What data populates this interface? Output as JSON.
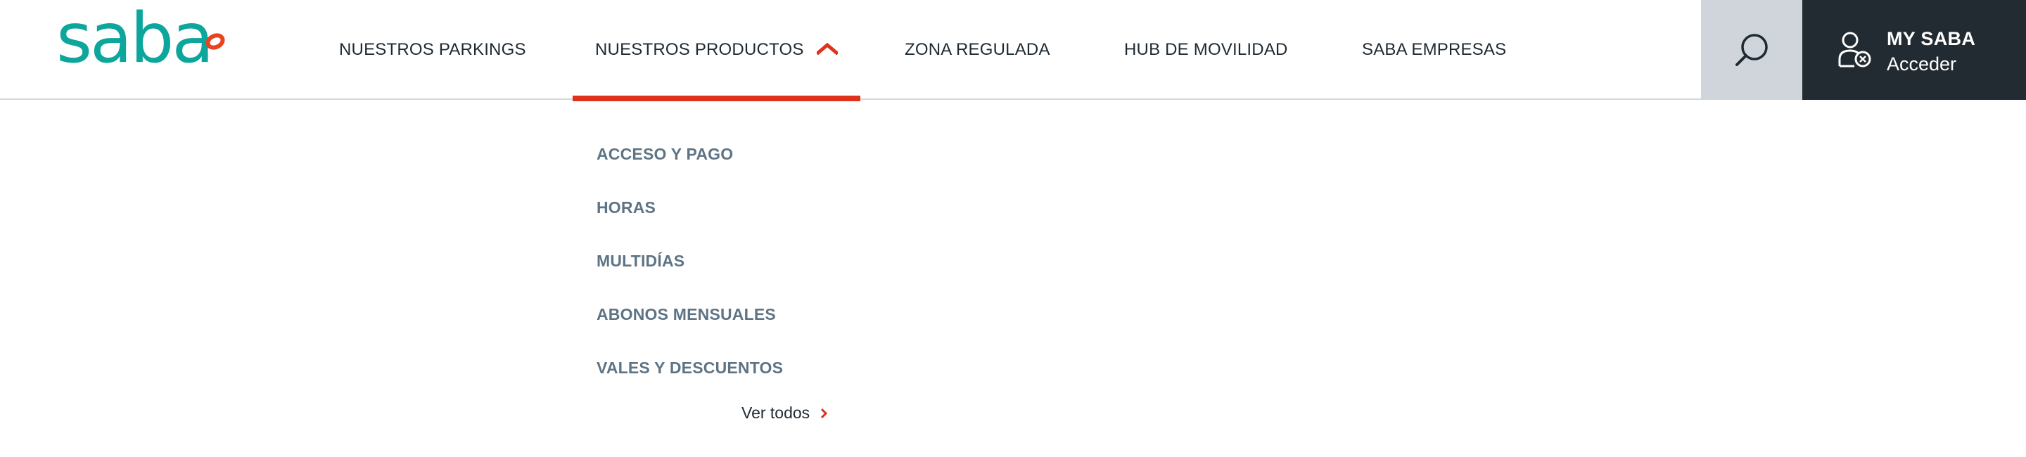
{
  "brand": {
    "logo_text": "saba",
    "accent_color": "#e0321b",
    "teal_color": "#0da69c"
  },
  "nav": {
    "items": [
      {
        "label": "NUESTROS PARKINGS",
        "active": false
      },
      {
        "label": "NUESTROS PRODUCTOS",
        "active": true
      },
      {
        "label": "ZONA REGULADA",
        "active": false
      },
      {
        "label": "HUB DE MOVILIDAD",
        "active": false
      },
      {
        "label": "SABA EMPRESAS",
        "active": false
      }
    ]
  },
  "search": {
    "icon": "search-icon"
  },
  "account": {
    "title": "MY SABA",
    "subtitle": "Acceder",
    "icon": "user-logged-out-icon"
  },
  "dropdown": {
    "items": [
      {
        "label": "ACCESO Y PAGO"
      },
      {
        "label": "HORAS"
      },
      {
        "label": "MULTIDÍAS"
      },
      {
        "label": "ABONOS MENSUALES"
      },
      {
        "label": "VALES Y DESCUENTOS"
      }
    ],
    "see_all": "Ver todos"
  }
}
